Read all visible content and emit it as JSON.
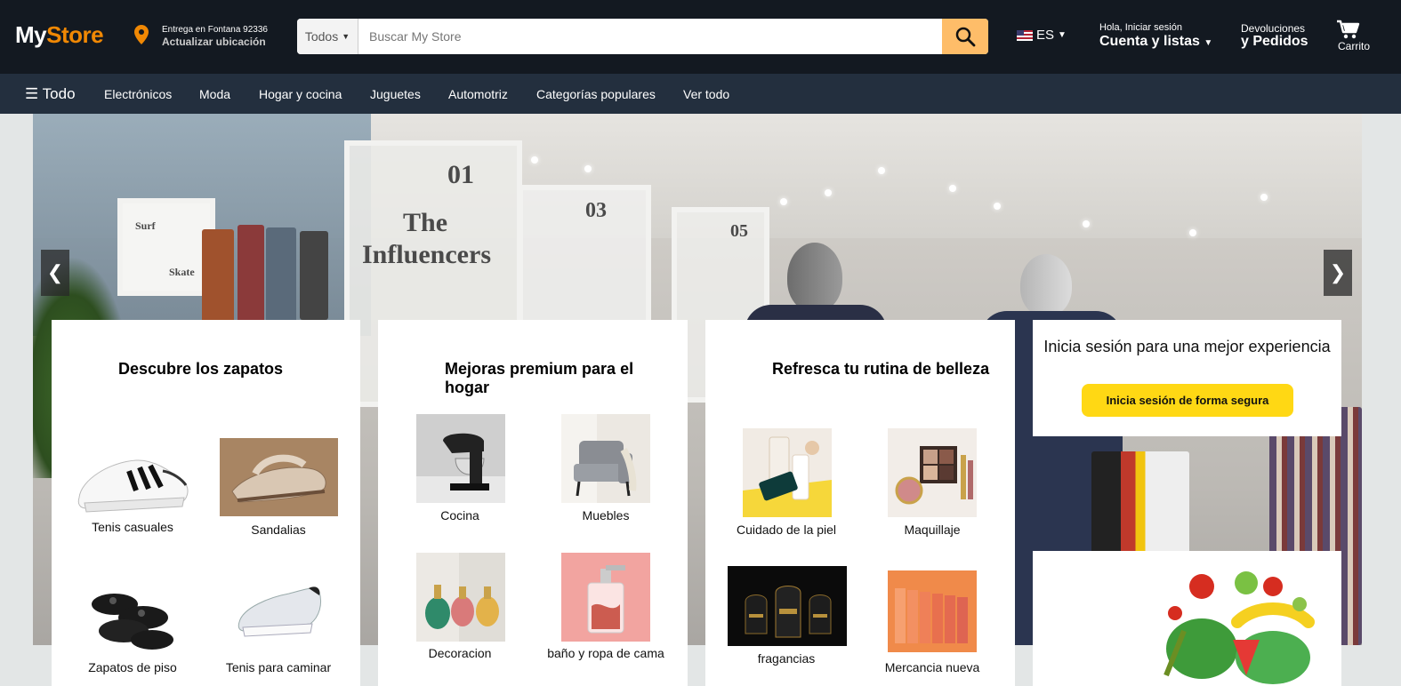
{
  "header": {
    "logo_prefix": "My",
    "logo_suffix": "Store",
    "location_line1": "Entrega en Fontana 92336",
    "location_line2": "Actualizar ubicación",
    "search_category": "Todos",
    "search_placeholder": "Buscar My Store",
    "language": "ES",
    "account_line1": "Hola, Iniciar sesión",
    "account_line2": "Cuenta y listas",
    "returns_line1": "Devoluciones",
    "returns_line2": "y Pedidos",
    "cart_label": "Carrito"
  },
  "nav": {
    "all_label": "☰ Todo",
    "items": [
      "Electrónicos",
      "Moda",
      "Hogar y cocina",
      "Juguetes",
      "Automotriz",
      "Categorías populares",
      "Ver todo"
    ]
  },
  "hero": {
    "prev_label": "❮",
    "next_label": "❯",
    "signs": [
      "Surf",
      "Skate",
      "01",
      "The",
      "Influencers",
      "03",
      "05",
      "O"
    ]
  },
  "cards": [
    {
      "title": "Descubre los zapatos",
      "tiles": [
        "Tenis casuales",
        "Sandalias",
        "Zapatos de piso",
        "Tenis para caminar"
      ]
    },
    {
      "title": "Mejoras premium para el hogar",
      "tiles": [
        "Cocina",
        "Muebles",
        "Decoracion",
        "baño y ropa de cama"
      ]
    },
    {
      "title": "Refresca tu rutina de belleza",
      "tiles": [
        "Cuidado de la piel",
        "Maquillaje",
        "fragancias",
        "Mercancia nueva"
      ]
    }
  ],
  "signin_card": {
    "title": "Inicia sesión para una mejor experiencia",
    "button_label": "Inicia sesión de forma segura"
  },
  "icons": {
    "location": "location-pin-icon",
    "search": "search-icon",
    "cart": "cart-icon",
    "flag": "us-flag-icon"
  },
  "colors": {
    "header_bg": "#131921",
    "nav_bg": "#232f3e",
    "accent": "#f08804",
    "search_button": "#febd69",
    "signin_button": "#ffd814"
  }
}
